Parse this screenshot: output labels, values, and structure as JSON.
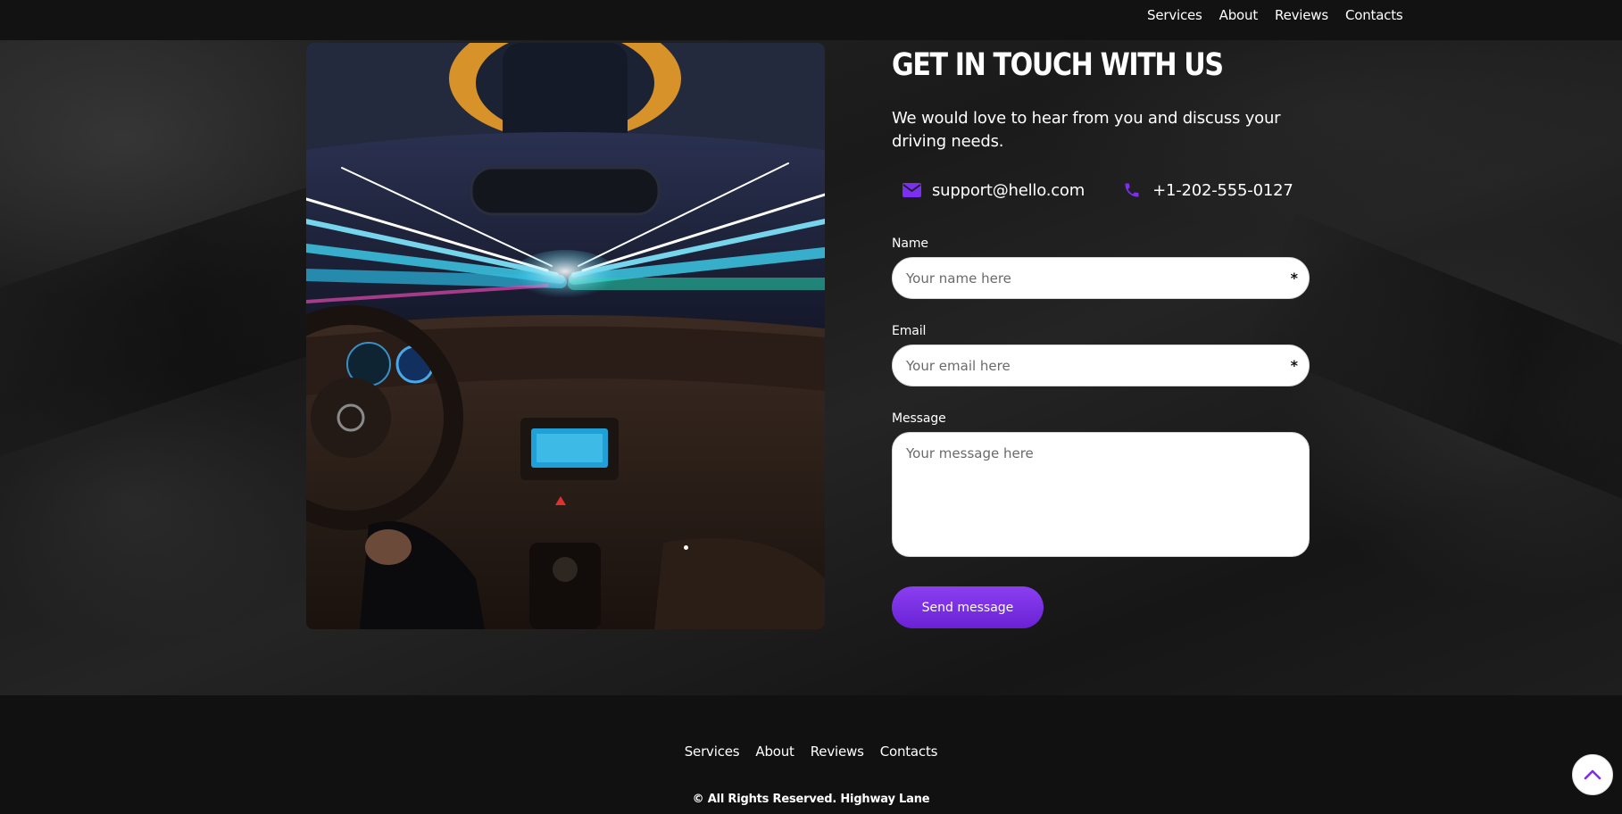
{
  "header": {
    "nav": [
      {
        "label": "Services"
      },
      {
        "label": "About"
      },
      {
        "label": "Reviews"
      },
      {
        "label": "Contacts"
      }
    ]
  },
  "contact": {
    "title": "GET IN TOUCH WITH US",
    "lead": "We would love to hear from you and discuss your driving needs.",
    "email": "support@hello.com",
    "phone": "+1-202-555-0127",
    "email_icon": "envelope-icon",
    "phone_icon": "phone-icon",
    "accent_color": "#7b2ff0"
  },
  "form": {
    "name_label": "Name",
    "name_placeholder": "Your name here",
    "email_label": "Email",
    "email_placeholder": "Your email here",
    "message_label": "Message",
    "message_placeholder": "Your message here",
    "required_marker": "*",
    "submit_label": "Send message"
  },
  "footer": {
    "nav": [
      {
        "label": "Services"
      },
      {
        "label": "About"
      },
      {
        "label": "Reviews"
      },
      {
        "label": "Contacts"
      }
    ],
    "copyright": "© All Rights Reserved. Highway Lane",
    "scroll_top_icon": "chevron-up-icon"
  }
}
